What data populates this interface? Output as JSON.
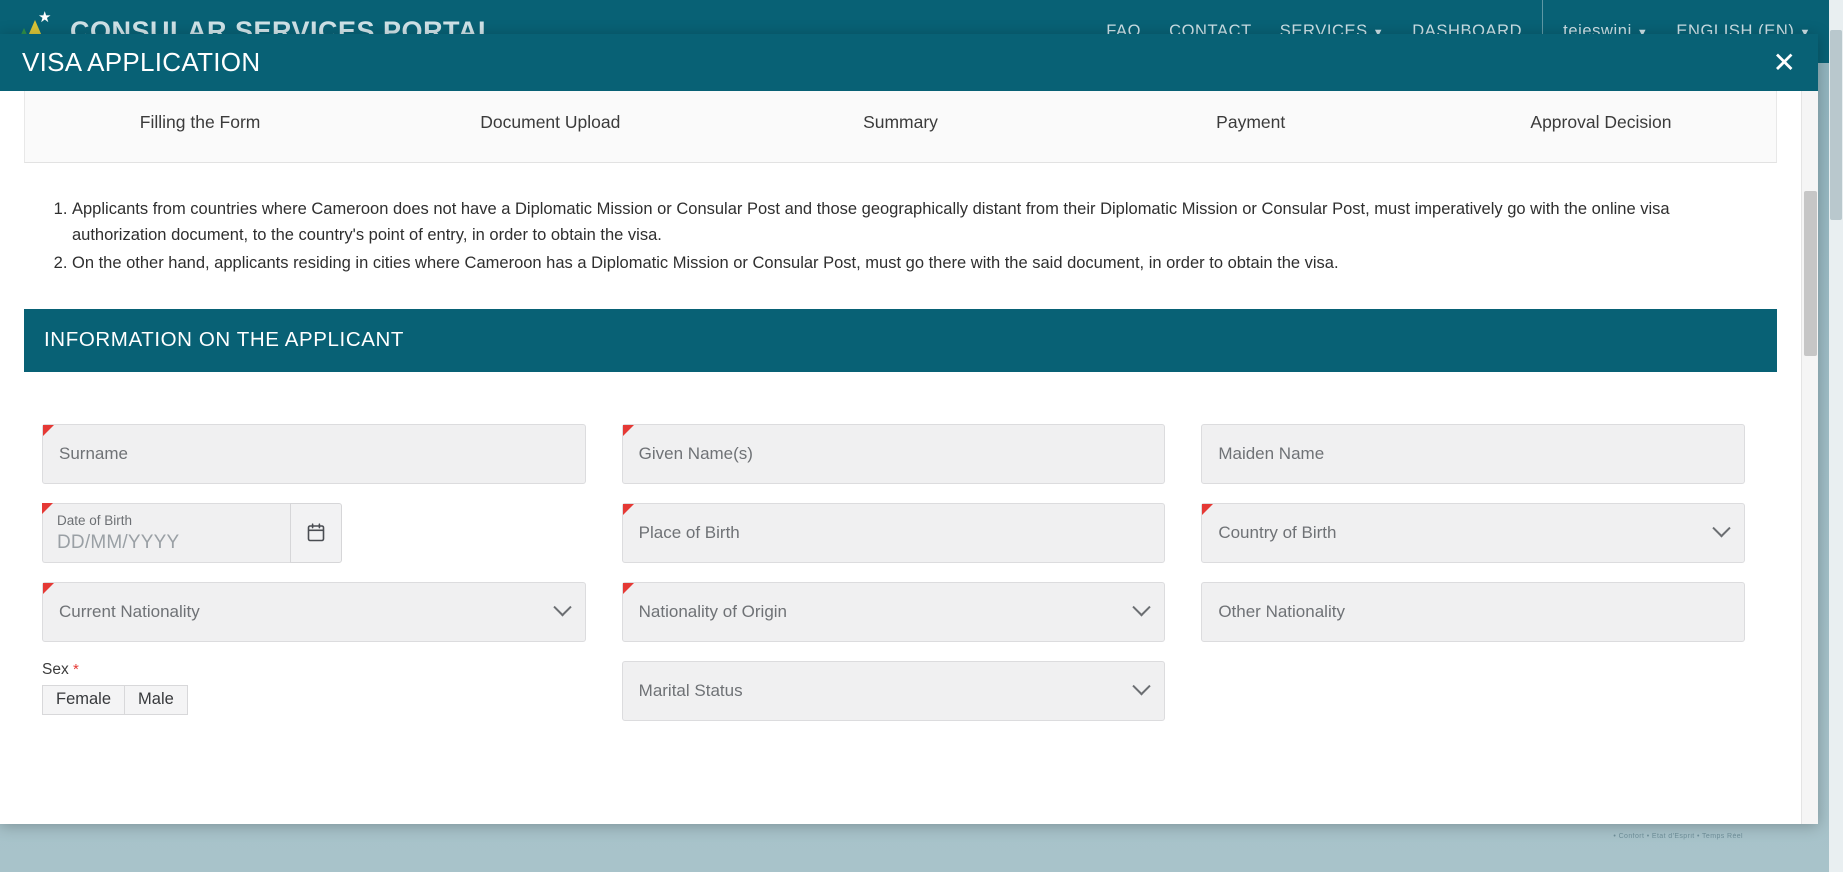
{
  "portal": {
    "title": "CONSULAR SERVICES PORTAL",
    "nav": [
      {
        "label": "FAQ",
        "caret": false
      },
      {
        "label": "CONTACT",
        "caret": false
      },
      {
        "label": "SERVICES",
        "caret": true
      },
      {
        "label": "DASHBOARD",
        "caret": false
      }
    ],
    "account": {
      "label": "tejeswini",
      "caret": true
    },
    "language": {
      "label": "ENGLISH (EN)",
      "caret": true
    },
    "microtext": "• Confort • Etat d'Esprit • Temps Réel"
  },
  "modal": {
    "title": "VISA APPLICATION",
    "close_label": "✕"
  },
  "stepper": {
    "steps": [
      "Filling the Form",
      "Document Upload",
      "Summary",
      "Payment",
      "Approval Decision"
    ]
  },
  "notes": [
    "Applicants from countries where Cameroon does not have a Diplomatic Mission or Consular Post and those geographically distant from their Diplomatic Mission or Consular Post, must imperatively go with the online visa authorization document, to the country's point of entry, in order to obtain the visa.",
    "On the other hand, applicants residing in cities where Cameroon has a Diplomatic Mission or Consular Post, must go there with the said document, in order to obtain the visa."
  ],
  "applicant": {
    "section_title": "INFORMATION ON THE APPLICANT",
    "fields": {
      "surname": {
        "placeholder": "Surname",
        "required": true,
        "type": "text"
      },
      "given_names": {
        "placeholder": "Given Name(s)",
        "required": true,
        "type": "text"
      },
      "maiden_name": {
        "placeholder": "Maiden Name",
        "required": false,
        "type": "text"
      },
      "date_of_birth": {
        "label": "Date of Birth",
        "placeholder": "DD/MM/YYYY",
        "required": true,
        "type": "date",
        "icon": "calendar-icon"
      },
      "place_of_birth": {
        "placeholder": "Place of Birth",
        "required": true,
        "type": "text"
      },
      "country_of_birth": {
        "placeholder": "Country of Birth",
        "required": true,
        "type": "select"
      },
      "current_nationality": {
        "placeholder": "Current Nationality",
        "required": true,
        "type": "select"
      },
      "nationality_of_origin": {
        "placeholder": "Nationality of Origin",
        "required": true,
        "type": "select"
      },
      "other_nationality": {
        "placeholder": "Other Nationality",
        "required": false,
        "type": "text"
      },
      "sex": {
        "label": "Sex",
        "required_mark": "*",
        "options": [
          "Female",
          "Male"
        ]
      },
      "marital_status": {
        "placeholder": "Marital Status",
        "required": false,
        "type": "select"
      }
    }
  },
  "colors": {
    "brand_teal": "#086175",
    "required_red": "#e53935",
    "field_bg": "#f0f0f1"
  }
}
